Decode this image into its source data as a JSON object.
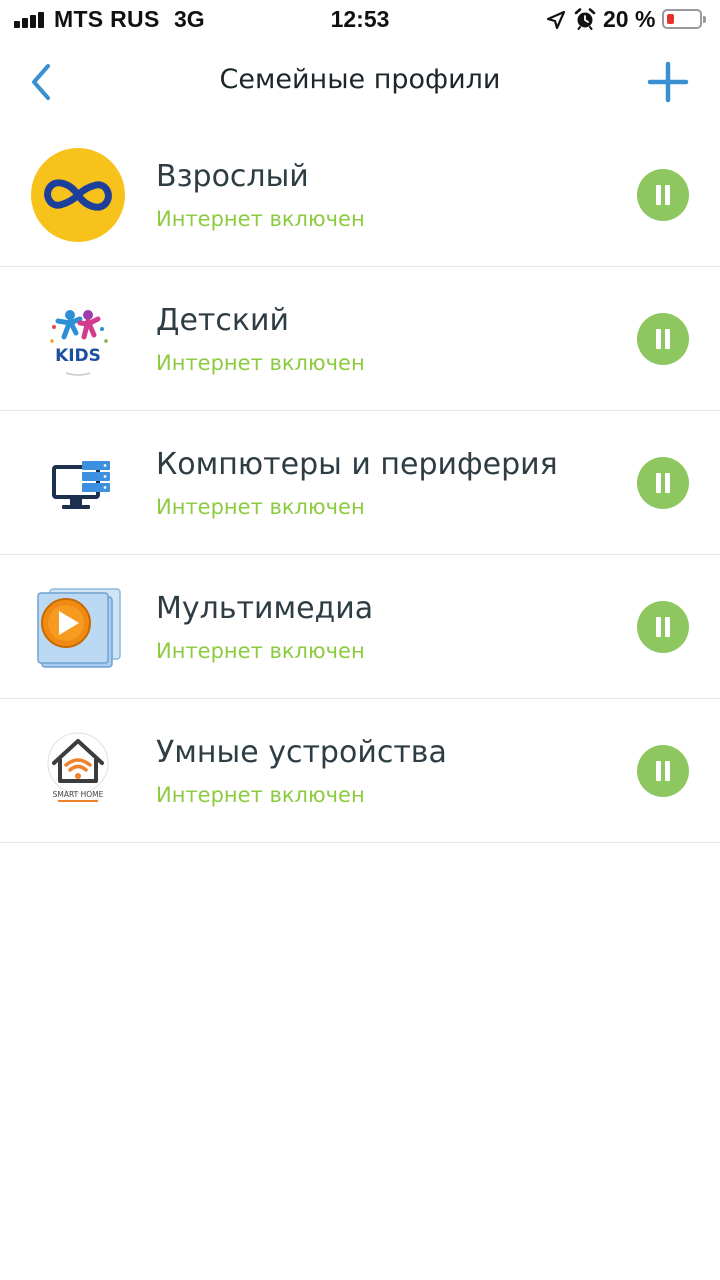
{
  "status_bar": {
    "carrier": "MTS RUS",
    "network": "3G",
    "time": "12:53",
    "battery_percent": "20 %",
    "icons": [
      "signal-icon",
      "location-icon",
      "alarm-icon",
      "battery-icon"
    ]
  },
  "nav": {
    "title": "Семейные профили",
    "back_icon": "chevron-left-icon",
    "add_icon": "plus-icon"
  },
  "colors": {
    "accent": "#3a8fd1",
    "status_green": "#8ccb3f",
    "pause_green": "#8ec760",
    "battery_low": "#e5322c"
  },
  "profiles": [
    {
      "name": "Взрослый",
      "status": "Интернет включен",
      "icon": "infinity-icon"
    },
    {
      "name": "Детский",
      "status": "Интернет включен",
      "icon": "kids-logo",
      "logo_text": "KIDS"
    },
    {
      "name": "Компютеры и периферия",
      "status": "Интернет включен",
      "icon": "computer-monitor-icon"
    },
    {
      "name": "Мультимедиа",
      "status": "Интернет включен",
      "icon": "media-player-icon"
    },
    {
      "name": "Умные устройства",
      "status": "Интернет включен",
      "icon": "smart-home-logo",
      "logo_text": "SMART HOME"
    }
  ]
}
